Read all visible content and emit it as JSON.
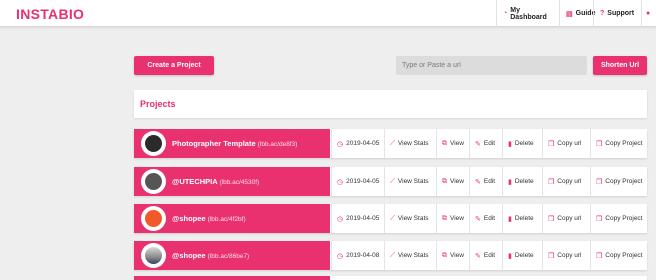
{
  "header": {
    "logo": "INSTABIO",
    "nav": [
      {
        "label": "My Dashboard",
        "icon": "dashboard-icon"
      },
      {
        "label": "Guide",
        "icon": "book-icon"
      },
      {
        "label": "Support",
        "icon": "help-icon"
      }
    ],
    "user_icon": "user-icon"
  },
  "toolbar": {
    "create_label": "Create a Project",
    "url_placeholder": "Type or Paste a url",
    "shorten_label": "Shorten Url"
  },
  "projects": {
    "title": "Projects",
    "actions": {
      "view_stats": "View Stats",
      "view": "View",
      "edit": "Edit",
      "delete": "Delete",
      "copy_url": "Copy url",
      "copy_project": "Copy Project"
    },
    "items": [
      {
        "title": "Photographer Template",
        "link": "(lbb.ac/de8f3)",
        "date": "2019-04-05"
      },
      {
        "title": "@UTECHPIA",
        "link": "(lbb.ac/4530f)",
        "date": "2019-04-05"
      },
      {
        "title": "@shopee",
        "link": "(lbb.ac/4f2bf)",
        "date": "2019-04-05"
      },
      {
        "title": "@shopee",
        "link": "(lbb.ac/86be7)",
        "date": "2019-04-08"
      }
    ]
  },
  "colors": {
    "accent": "#e8316e",
    "background": "#eeeeee"
  }
}
